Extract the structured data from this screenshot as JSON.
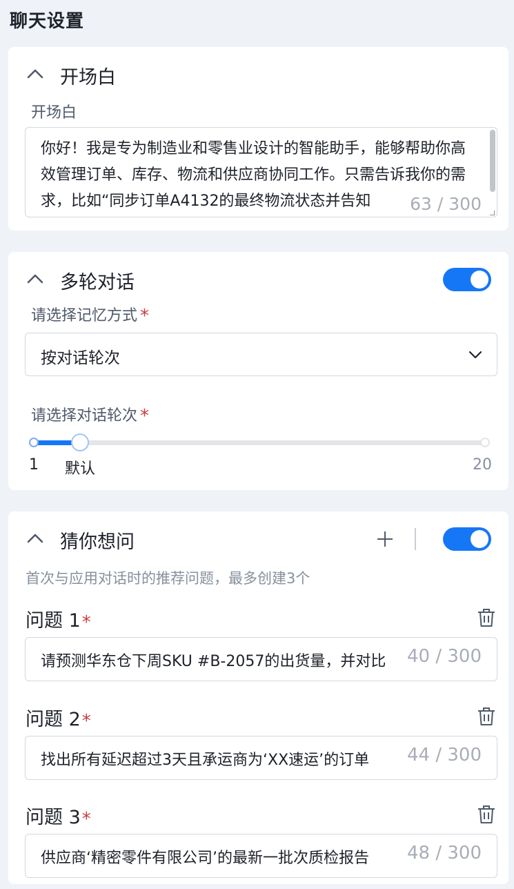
{
  "page": {
    "title": "聊天设置"
  },
  "opening": {
    "title": "开场白",
    "field_label": "开场白",
    "text": "你好！我是专为制造业和零售业设计的智能助手，能够帮助你高效管理订单、库存、物流和供应商协同工作。只需告诉我你的需求，比如“同步订单A4132的最终物流状态并告知",
    "count": "63 / 300"
  },
  "multi_turn": {
    "title": "多轮对话",
    "enabled": true,
    "memory_label": "请选择记忆方式",
    "memory_value": "按对话轮次",
    "rounds_label": "请选择对话轮次",
    "slider": {
      "min_label": "1",
      "default_label": "默认",
      "max_label": "20",
      "min": 1,
      "max": 20,
      "value": 3
    },
    "required_mark": "*"
  },
  "suggest": {
    "title": "猜你想问",
    "enabled": true,
    "hint": "首次与应用对话时的推荐问题，最多创建3个",
    "questions": [
      {
        "label": "问题 1",
        "text": "请预测华东仓下周SKU #B-2057的出货量，并对比",
        "count": "40 / 300"
      },
      {
        "label": "问题 2",
        "text": "找出所有延迟超过3天且承运商为‘XX速运’的订单",
        "count": "44 / 300"
      },
      {
        "label": "问题 3",
        "text": "供应商‘精密零件有限公司’的最新一批次质检报告",
        "count": "48 / 300"
      }
    ]
  },
  "icons": {
    "collapse": "chevron-up-icon",
    "dropdown": "chevron-down-icon",
    "add": "plus-icon",
    "delete": "trash-icon"
  },
  "colors": {
    "accent": "#1677f6",
    "required": "#c93c3c",
    "background": "#eff2f7"
  }
}
